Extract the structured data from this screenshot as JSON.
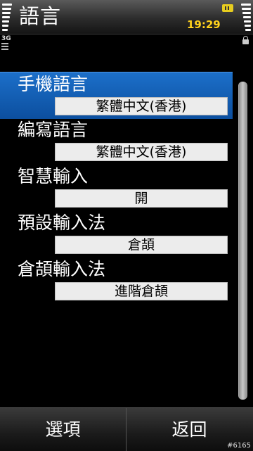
{
  "status_bar": {
    "title": "語言",
    "time": "19:29",
    "network": "3G",
    "battery_icon": "battery-icon",
    "accent_color": "#ffd21c"
  },
  "settings": [
    {
      "label": "手機語言",
      "value": "繁體中文(香港)",
      "selected": true
    },
    {
      "label": "編寫語言",
      "value": "繁體中文(香港)",
      "selected": false
    },
    {
      "label": "智慧輸入",
      "value": "開",
      "selected": false
    },
    {
      "label": "預設輸入法",
      "value": "倉頡",
      "selected": false
    },
    {
      "label": "倉頡輸入法",
      "value": "進階倉頡",
      "selected": false
    }
  ],
  "softkeys": {
    "left": "選項",
    "right": "返回"
  },
  "watermark": "#6165",
  "colors": {
    "selection": "#0c4f9f",
    "value_box": "#ececec"
  }
}
